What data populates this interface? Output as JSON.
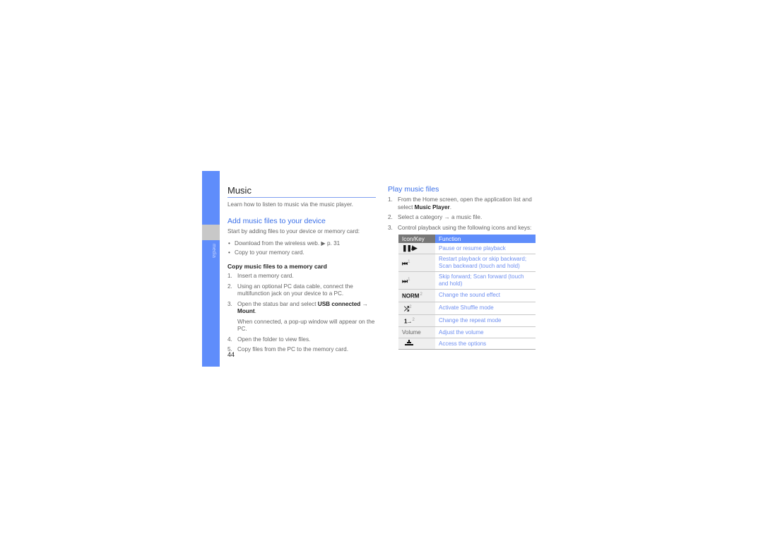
{
  "sidebar": {
    "section_label": "media"
  },
  "left": {
    "title": "Music",
    "intro": "Learn how to listen to music via the music player.",
    "add_section": {
      "heading": "Add music files to your device",
      "intro": "Start by adding files to your device or memory card:",
      "bullets": [
        "Download from the wireless web. ▶ p. 31",
        "Copy to your memory card."
      ],
      "sub_heading": "Copy music files to a memory card",
      "steps": [
        {
          "num": "1.",
          "text": "Insert a memory card."
        },
        {
          "num": "2.",
          "text": "Using an optional PC data cable, connect the multifunction jack on your device to a PC."
        },
        {
          "num": "3.",
          "text_before": "Open the status bar and select ",
          "bold1": "USB connected",
          "arrow": " → ",
          "bold2": "Mount",
          "text_after": ".",
          "note": "When connected, a pop-up window will appear on the PC."
        },
        {
          "num": "4.",
          "text": "Open the folder to view files."
        },
        {
          "num": "5.",
          "text": "Copy files from the PC to the memory card."
        }
      ]
    },
    "page_number": "44"
  },
  "right": {
    "heading": "Play music files",
    "steps": [
      {
        "num": "1.",
        "text_before": "From the Home screen, open the application list and select ",
        "bold": "Music Player",
        "text_after": "."
      },
      {
        "num": "2.",
        "text": "Select a category → a music file."
      },
      {
        "num": "3.",
        "text": "Control playback using the following icons and keys:"
      }
    ],
    "table": {
      "headers": [
        "Icon/Key",
        "Function"
      ],
      "rows": [
        {
          "icon": "pause-play-icon",
          "key": "❚❚/▶",
          "sup": "",
          "function": "Pause or resume playback"
        },
        {
          "icon": "skip-backward-icon",
          "key": "⏮",
          "sup": "1",
          "function": "Restart playback or skip backward; Scan backward (touch and hold)"
        },
        {
          "icon": "skip-forward-icon",
          "key": "⏭",
          "sup": "1",
          "function": "Skip forward; Scan forward (touch and hold)"
        },
        {
          "icon": "sound-effect-icon",
          "key": "NORM",
          "sup": "2",
          "function": "Change the sound effect"
        },
        {
          "icon": "shuffle-icon",
          "key": "⤮",
          "sup": "2",
          "function": "Activate Shuffle mode"
        },
        {
          "icon": "repeat-mode-icon",
          "key": "1→",
          "sup": "2",
          "function": "Change the repeat mode"
        },
        {
          "icon": "volume-key",
          "key": "Volume",
          "sup": "",
          "function": "Adjust the volume"
        },
        {
          "icon": "options-icon",
          "key": "⨊",
          "sup": "",
          "function": "Access the options"
        }
      ]
    }
  },
  "colors": {
    "accent_blue": "#5f8dfb",
    "heading_blue": "#3a6fe8",
    "function_text_blue": "#6e8ff0",
    "header_gray": "#777777",
    "tab_gray": "#c8c8c8"
  }
}
